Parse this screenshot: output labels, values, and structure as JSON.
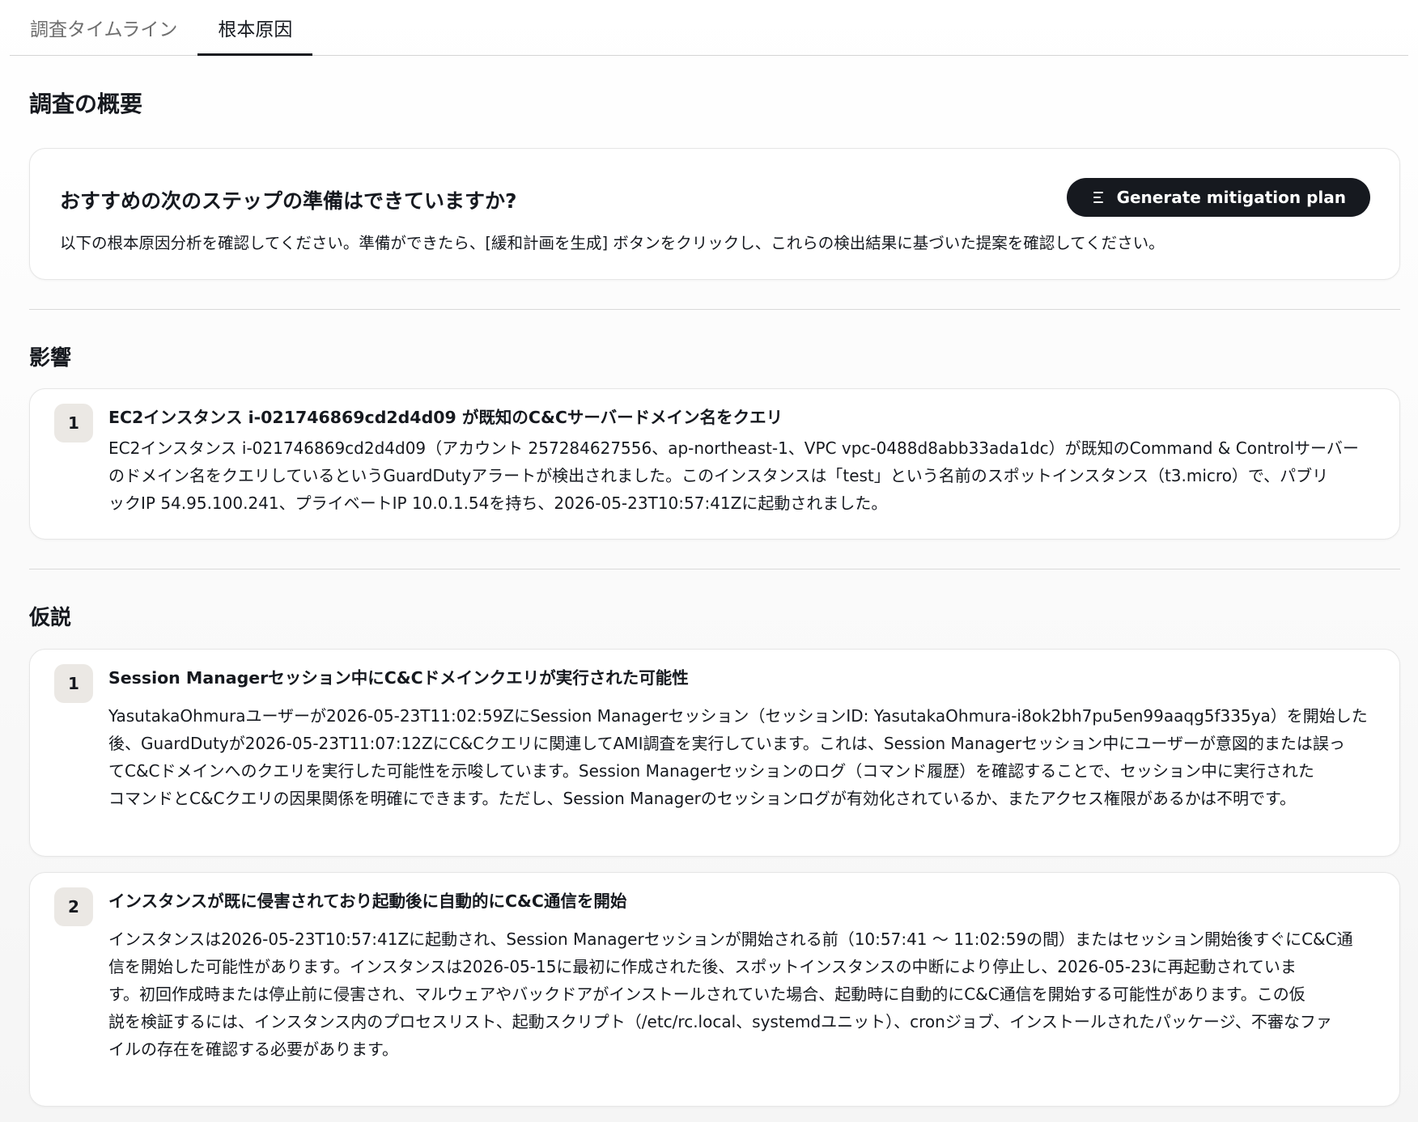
{
  "tabs": [
    {
      "label": "調査タイムライン",
      "active": false
    },
    {
      "label": "根本原因",
      "active": true
    }
  ],
  "overview": {
    "section_title": "調査の概要",
    "heading": "おすすめの次のステップの準備はできていますか?",
    "description": "以下の根本原因分析を確認してください。準備ができたら、[緩和計画を生成] ボタンをクリックし、これらの検出結果に基づいた提案を確認してください。",
    "button_label": "Generate mitigation plan",
    "button_icon": "list-icon"
  },
  "impact": {
    "section_title": "影響",
    "items": [
      {
        "number": "1",
        "title": "EC2インスタンス i-021746869cd2d4d09 が既知のC&Cサーバードメイン名をクエリ",
        "lines": [
          "EC2インスタンス i-021746869cd2d4d09（アカウント 257284627556、ap-northeast-1、VPC vpc-0488d8abb33ada1dc）が既知のCommand & Controlサーバー",
          "のドメイン名をクエリしているというGuardDutyアラートが検出されました。このインスタンスは「test」という名前のスポットインスタンス（t3.micro）で、パブリ",
          "ックIP 54.95.100.241、プライベートIP 10.0.1.54を持ち、2026-05-23T10:57:41Zに起動されました。"
        ]
      }
    ]
  },
  "hypotheses": {
    "section_title": "仮説",
    "items": [
      {
        "number": "1",
        "title": "Session Managerセッション中にC&Cドメインクエリが実行された可能性",
        "lines": [
          "YasutakaOhmuraユーザーが2026-05-23T11:02:59ZにSession Managerセッション（セッションID: YasutakaOhmura-i8ok2bh7pu5en99aaqg5f335ya）を開始した",
          "後、GuardDutyが2026-05-23T11:07:12ZにC&Cクエリに関連してAMI調査を実行しています。これは、Session Managerセッション中にユーザーが意図的または誤っ",
          "てC&Cドメインへのクエリを実行した可能性を示唆しています。Session Managerセッションのログ（コマンド履歴）を確認することで、セッション中に実行された",
          "コマンドとC&Cクエリの因果関係を明確にできます。ただし、Session Managerのセッションログが有効化されているか、またアクセス権限があるかは不明です。"
        ]
      },
      {
        "number": "2",
        "title": "インスタンスが既に侵害されており起動後に自動的にC&C通信を開始",
        "lines": [
          "インスタンスは2026-05-23T10:57:41Zに起動され、Session Managerセッションが開始される前（10:57:41 〜 11:02:59の間）またはセッション開始後すぐにC&C通",
          "信を開始した可能性があります。インスタンスは2026-05-15に最初に作成された後、スポットインスタンスの中断により停止し、2026-05-23に再起動されていま",
          "す。初回作成時または停止前に侵害され、マルウェアやバックドアがインストールされていた場合、起動時に自動的にC&C通信を開始する可能性があります。この仮",
          "説を検証するには、インスタンス内のプロセスリスト、起動スクリプト（/etc/rc.local、systemdユニット）、cronジョブ、インストールされたパッケージ、不審なファ",
          "イルの存在を確認する必要があります。"
        ]
      }
    ]
  },
  "colors": {
    "accent": "#16191f",
    "badge_bg": "#ebe8e4",
    "border": "#e6e6e6"
  }
}
